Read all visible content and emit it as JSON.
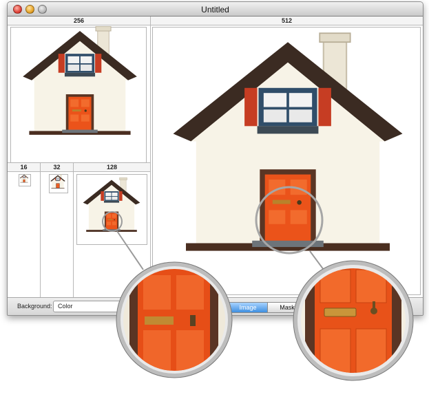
{
  "window": {
    "title": "Untitled"
  },
  "columns": {
    "c256": "256",
    "c512": "512",
    "c16": "16",
    "c32": "32",
    "c128": "128"
  },
  "bottom": {
    "background_label": "Background:",
    "background_value": "Color",
    "segments": [
      "Image",
      "Mask"
    ],
    "selected": "Image"
  },
  "colors": {
    "door": "#e8501a",
    "shutter": "#c43b22",
    "wall": "#f6f3e8",
    "roof": "#3a2a22",
    "window_frame": "#2f4f6b",
    "selection": "#4a97e3"
  }
}
